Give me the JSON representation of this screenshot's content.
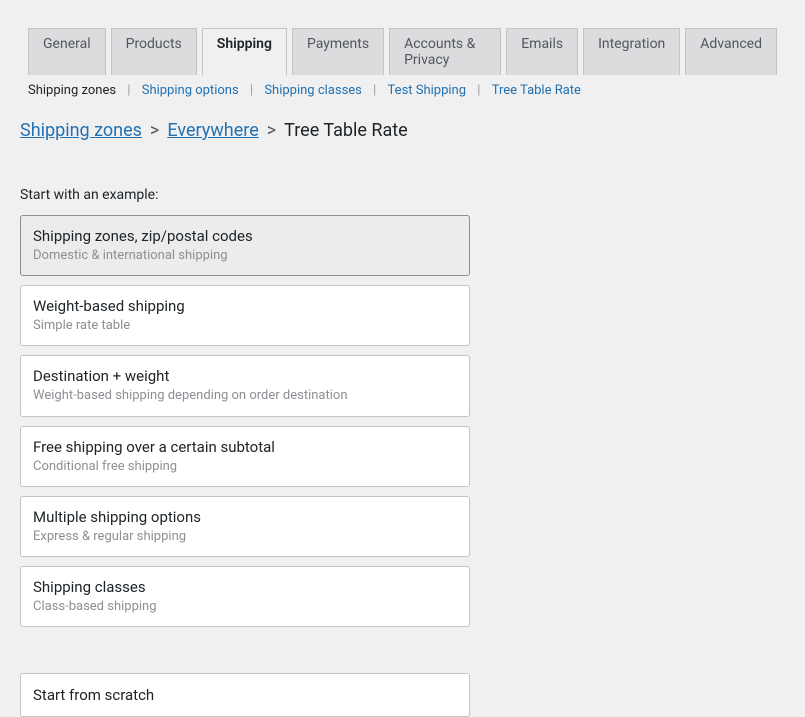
{
  "tabs": [
    {
      "label": "General"
    },
    {
      "label": "Products"
    },
    {
      "label": "Shipping"
    },
    {
      "label": "Payments"
    },
    {
      "label": "Accounts & Privacy"
    },
    {
      "label": "Emails"
    },
    {
      "label": "Integration"
    },
    {
      "label": "Advanced"
    }
  ],
  "subnav": [
    {
      "label": "Shipping zones"
    },
    {
      "label": "Shipping options"
    },
    {
      "label": "Shipping classes"
    },
    {
      "label": "Test Shipping"
    },
    {
      "label": "Tree Table Rate"
    }
  ],
  "breadcrumb": {
    "zones": "Shipping zones",
    "everywhere": "Everywhere",
    "current": "Tree Table Rate"
  },
  "section_label": "Start with an example:",
  "options": [
    {
      "title": "Shipping zones, zip/postal codes",
      "desc": "Domestic & international shipping"
    },
    {
      "title": "Weight-based shipping",
      "desc": "Simple rate table"
    },
    {
      "title": "Destination + weight",
      "desc": "Weight-based shipping depending on order destination"
    },
    {
      "title": "Free shipping over a certain subtotal",
      "desc": "Conditional free shipping"
    },
    {
      "title": "Multiple shipping options",
      "desc": "Express & regular shipping"
    },
    {
      "title": "Shipping classes",
      "desc": "Class-based shipping"
    }
  ],
  "scratch": {
    "label": "Start from scratch"
  }
}
